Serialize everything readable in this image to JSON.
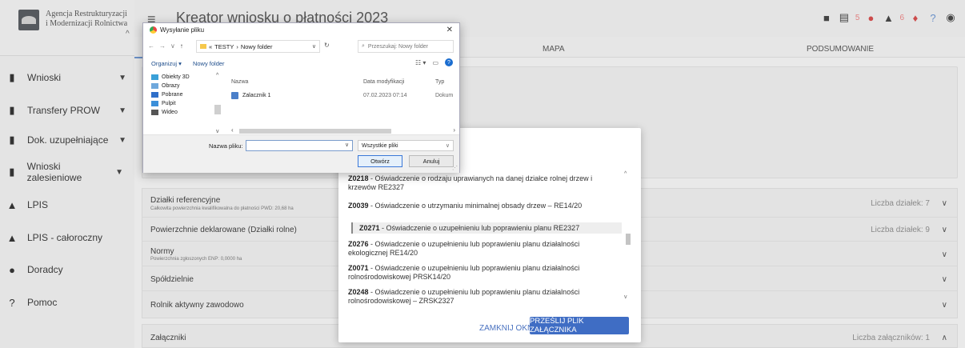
{
  "sidebar": {
    "logo_line1": "Agencja Restrukturyzacji",
    "logo_line2": "i Modernizacji Rolnictwa",
    "items": [
      {
        "label": "Wnioski",
        "icon": "document-icon"
      },
      {
        "label": "Transfery PROW",
        "icon": "document-icon"
      },
      {
        "label": "Dok. uzupełniające",
        "icon": "document-icon"
      },
      {
        "label": "Wnioski zalesieniowe",
        "icon": "document-icon"
      },
      {
        "label": "LPIS",
        "icon": "terrain-icon"
      },
      {
        "label": "LPIS - całoroczny",
        "icon": "terrain-icon"
      },
      {
        "label": "Doradcy",
        "icon": "person-icon"
      },
      {
        "label": "Pomoc",
        "icon": "help-icon"
      }
    ]
  },
  "header": {
    "title": "Kreator wniosku o płatności 2023",
    "warnings_count": "5",
    "alerts_count": "6"
  },
  "tabs": [
    "MAPA",
    "PODSUMOWANIE"
  ],
  "sections": [
    {
      "title": "Działki referencyjne",
      "subtitle": "Całkowita powierzchnia kwalifikowalna do płatności PWD: 20,68 ha",
      "right": "Liczba działek: 7"
    },
    {
      "title": "Powierzchnie deklarowane (Działki rolne)",
      "subtitle": "",
      "right": "Liczba działek: 9"
    },
    {
      "title": "Normy",
      "subtitle": "Powierzchnia zgłoszonych ENP: 0,0000 ha",
      "right": ""
    },
    {
      "title": "Spółdzielnie",
      "subtitle": "",
      "right": ""
    },
    {
      "title": "Rolnik aktywny zawodowo",
      "subtitle": "",
      "right": ""
    }
  ],
  "attachments": {
    "title": "Załączniki",
    "right": "Liczba załączników: 1"
  },
  "modal": {
    "options": [
      {
        "code": "Z0218",
        "text": " - Oświadczenie o rodzaju uprawianych na danej działce rolnej drzew i krzewów RE2327"
      },
      {
        "code": "Z0039",
        "text": " - Oświadczenie o utrzymaniu minimalnej obsady drzew – RE14/20"
      },
      {
        "code": "Z0271",
        "text": " - Oświadczenie o uzupełnieniu lub poprawieniu planu RE2327"
      },
      {
        "code": "Z0276",
        "text": " - Oświadczenie o uzupełnieniu lub poprawieniu planu działalności ekologicznej RE14/20"
      },
      {
        "code": "Z0071",
        "text": " - Oświadczenie o uzupełnieniu lub poprawieniu planu działalności rolnośrodowiskowej PRSK14/20"
      },
      {
        "code": "Z0248",
        "text": " - Oświadczenie o uzupełnieniu lub poprawieniu planu działalności rolnośrodowiskowej – ZRSK2327"
      }
    ],
    "close_label": "ZAMKNIJ OKNO",
    "send_label": "PRZEŚLIJ PLIK ZAŁĄCZNIKA"
  },
  "file_dialog": {
    "title": "Wysyłanie pliku",
    "path_prefix": "«",
    "path_1": "TESTY",
    "path_2": "Nowy folder",
    "search_placeholder": "Przeszukaj: Nowy folder",
    "organize": "Organizuj ▾",
    "new_folder": "Nowy folder",
    "tree": [
      {
        "label": "Obiekty 3D",
        "color": "#3aa0d8"
      },
      {
        "label": "Obrazy",
        "color": "#6fa8dc"
      },
      {
        "label": "Pobrane",
        "color": "#2f6fc9"
      },
      {
        "label": "Pulpit",
        "color": "#3b8fd9"
      },
      {
        "label": "Wideo",
        "color": "#555555"
      }
    ],
    "columns": {
      "name": "Nazwa",
      "modified": "Data modyfikacji",
      "type": "Typ"
    },
    "file": {
      "name": "Zalacznik 1",
      "modified": "07.02.2023 07:14",
      "type": "Dokum"
    },
    "filename_label": "Nazwa pliku:",
    "filetype": "Wszystkie pliki",
    "open_label": "Otwórz",
    "cancel_label": "Anuluj"
  }
}
